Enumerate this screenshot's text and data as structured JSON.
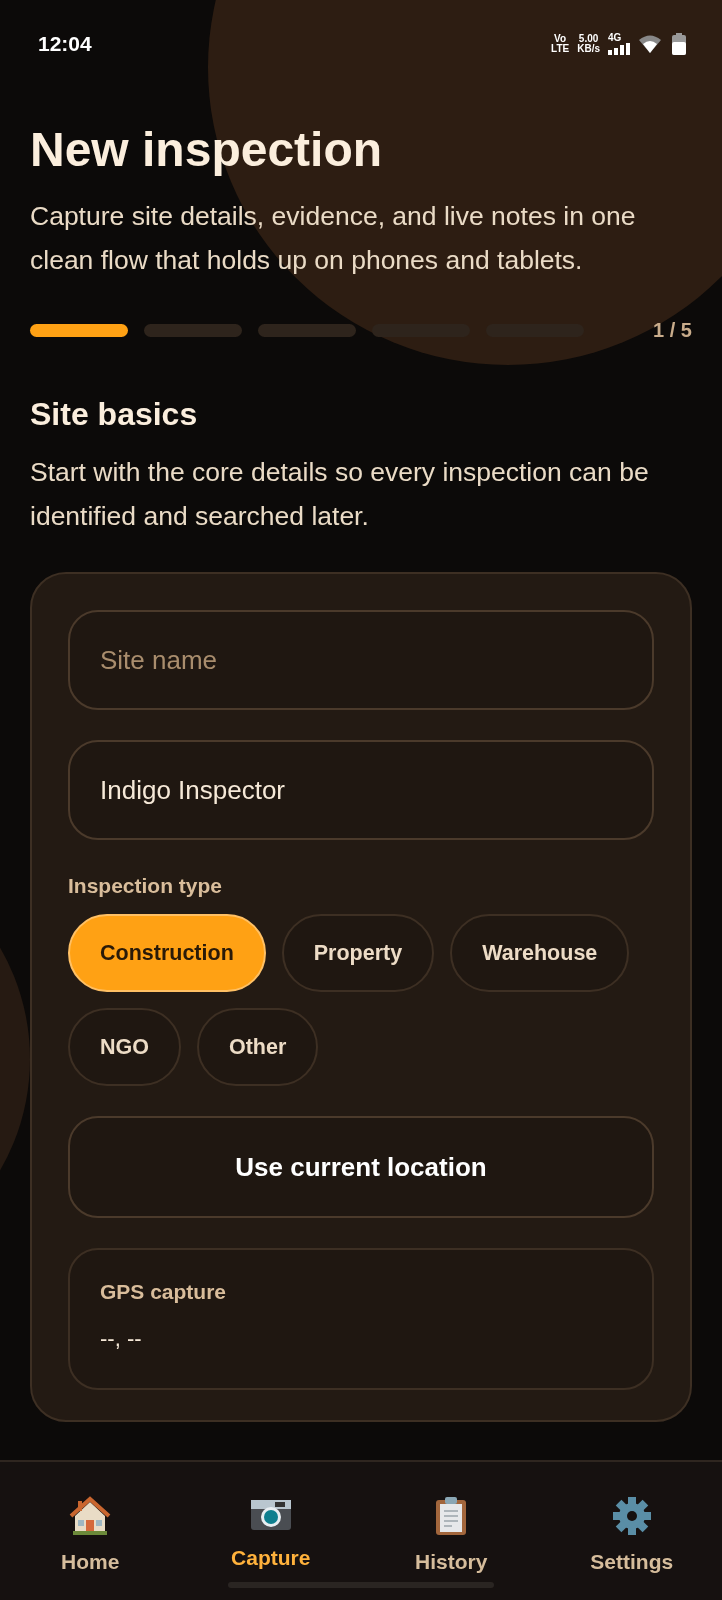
{
  "status_bar": {
    "time": "12:04",
    "volte_top": "Vo",
    "volte_bottom": "LTE",
    "speed_value": "5.00",
    "speed_unit": "KB/s",
    "network": "4G"
  },
  "header": {
    "title": "New inspection",
    "subtitle": "Capture site details, evidence, and live notes in one clean flow that holds up on phones and tablets."
  },
  "progress": {
    "steps": [
      {
        "active": true
      },
      {
        "active": false
      },
      {
        "active": false
      },
      {
        "active": false
      },
      {
        "active": false
      }
    ],
    "counter": "1 / 5"
  },
  "section": {
    "title": "Site basics",
    "description": "Start with the core details so every inspection can be identified and searched later."
  },
  "form": {
    "fields": [
      {
        "placeholder": "Site name"
      },
      {
        "value": "Indigo Inspector"
      }
    ],
    "type_label": "Inspection type",
    "chips": [
      {
        "label": "Construction",
        "selected": true
      },
      {
        "label": "Property",
        "selected": false
      },
      {
        "label": "Warehouse",
        "selected": false
      },
      {
        "label": "NGO",
        "selected": false
      },
      {
        "label": "Other",
        "selected": false
      }
    ],
    "location_button": "Use current location",
    "gps": {
      "label": "GPS capture",
      "value": "--, --"
    }
  },
  "nav": [
    {
      "label": "Home",
      "kind": "home",
      "selected": false
    },
    {
      "label": "Capture",
      "kind": "camera",
      "selected": true
    },
    {
      "label": "History",
      "kind": "clipboard",
      "selected": false
    },
    {
      "label": "Settings",
      "kind": "gear",
      "selected": false
    }
  ]
}
